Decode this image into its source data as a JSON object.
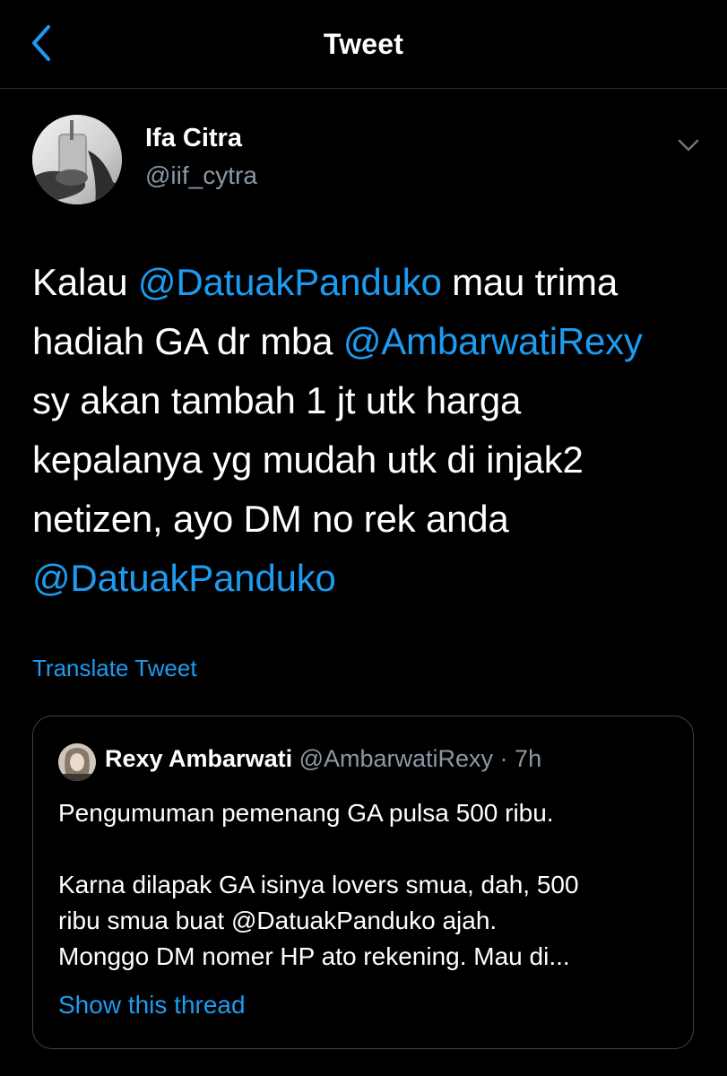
{
  "header": {
    "title": "Tweet",
    "back_icon": "chevron-left-icon"
  },
  "colors": {
    "background": "#000000",
    "accent": "#1d9bf0",
    "secondary_text": "#8b98a5",
    "border": "#38444d"
  },
  "tweet": {
    "author": {
      "name": "Ifa Citra",
      "handle": "@iif_cytra"
    },
    "more_icon": "chevron-down-icon",
    "lines": [
      [
        {
          "t": "Kalau "
        },
        {
          "m": "@DatuakPanduko"
        },
        {
          "t": " mau trima"
        }
      ],
      [
        {
          "t": "hadiah GA dr mba "
        },
        {
          "m": "@AmbarwatiRexy"
        }
      ],
      [
        {
          "t": "sy akan tambah 1 jt utk harga"
        }
      ],
      [
        {
          "t": "kepalanya yg mudah utk di injak2"
        }
      ],
      [
        {
          "t": "netizen, ayo DM no rek anda"
        }
      ],
      [
        {
          "m": "@DatuakPanduko"
        }
      ]
    ],
    "translate_label": "Translate Tweet"
  },
  "quoted_tweet": {
    "name": "Rexy Ambarwati",
    "handle_time": " @AmbarwatiRexy · 7h",
    "text": "Pengumuman pemenang GA pulsa 500 ribu.\n\nKarna dilapak GA isinya lovers smua, dah, 500\nribu smua buat @DatuakPanduko ajah.\nMonggo DM nomer HP ato rekening. Mau di...",
    "show_thread_label": "Show this thread"
  }
}
